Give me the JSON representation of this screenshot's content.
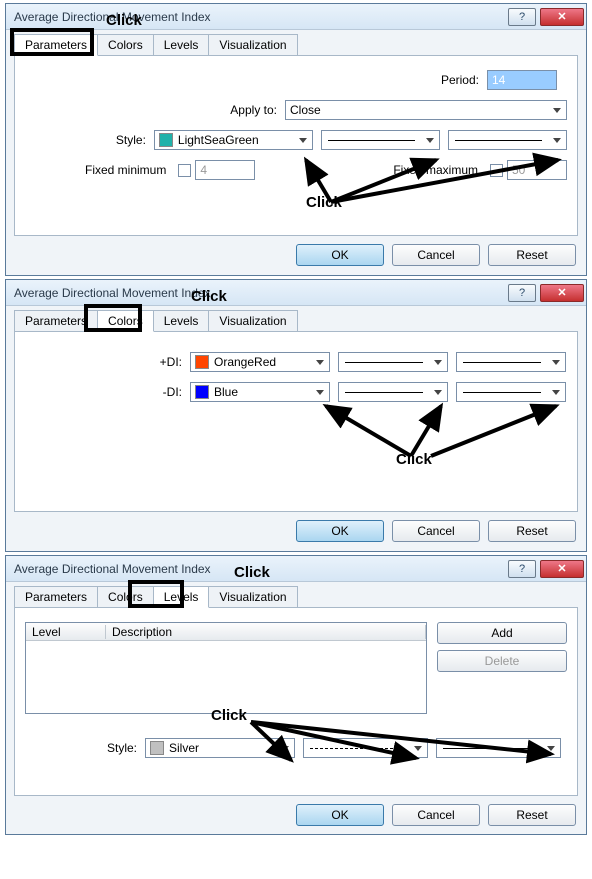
{
  "dialog_title": "Average Directional Movement Index",
  "tabs": {
    "parameters": "Parameters",
    "colors": "Colors",
    "levels": "Levels",
    "visualization": "Visualization"
  },
  "labels": {
    "period": "Period:",
    "apply_to": "Apply to:",
    "style": "Style:",
    "fixed_min": "Fixed minimum",
    "fixed_max": "Fixed maximum",
    "plus_di": "+DI:",
    "minus_di": "-DI:",
    "level": "Level",
    "description": "Description"
  },
  "values": {
    "period": "14",
    "apply_to": "Close",
    "style_color": "LightSeaGreen",
    "fixed_min_value": "4",
    "fixed_max_value": "50",
    "plus_di_color": "OrangeRed",
    "minus_di_color": "Blue",
    "levels_style_color": "Silver"
  },
  "colors": {
    "lightseagreen": "#20B2AA",
    "orangered": "#FF4500",
    "blue": "#0000FF",
    "silver": "#C0C0C0"
  },
  "buttons": {
    "ok": "OK",
    "cancel": "Cancel",
    "reset": "Reset",
    "add": "Add",
    "delete": "Delete"
  },
  "annotations": {
    "click": "Click"
  }
}
